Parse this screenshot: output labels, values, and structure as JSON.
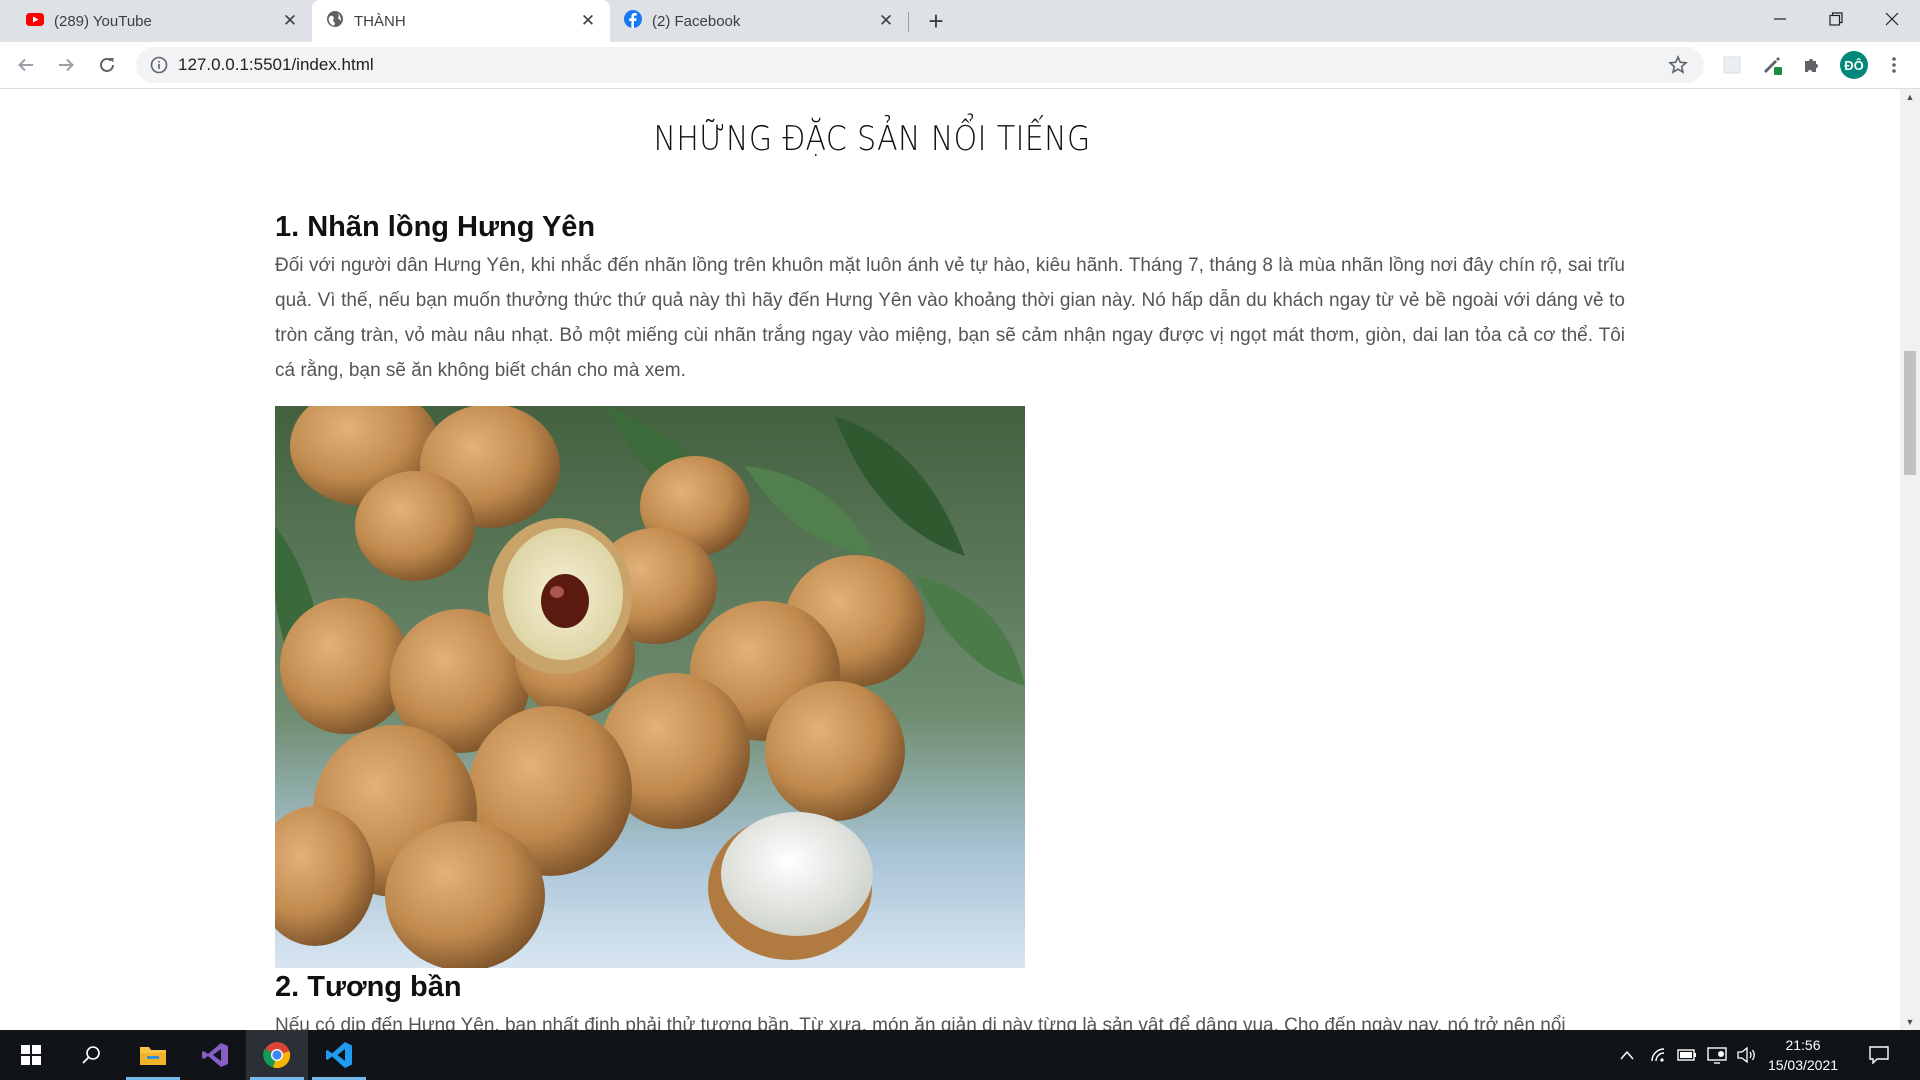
{
  "browser": {
    "tabs": [
      {
        "title": "(289) YouTube",
        "icon": "youtube-icon",
        "active": false
      },
      {
        "title": "THÀNH",
        "icon": "globe-icon",
        "active": true
      },
      {
        "title": "(2) Facebook",
        "icon": "facebook-icon",
        "active": false
      }
    ],
    "close_glyph": "✕",
    "new_tab_glyph": "+",
    "url": "127.0.0.1:5501/index.html",
    "profile_initials": "ĐÔ"
  },
  "page": {
    "title": "NHỮNG ĐẶC SẢN NỔI TIẾNG",
    "sections": [
      {
        "heading": "1. Nhãn lồng Hưng Yên",
        "text": "Đối với người dân Hưng Yên, khi nhắc đến nhãn lồng trên khuôn mặt luôn ánh vẻ tự hào, kiêu hãnh. Tháng 7, tháng 8 là mùa nhãn lồng nơi đây chín rộ, sai trĩu quả. Vì thế, nếu bạn muốn thưởng thức thứ quả này thì hãy đến Hưng Yên vào khoảng thời gian này. Nó hấp dẫn du khách ngay từ vẻ bề ngoài với dáng vẻ to tròn căng tràn, vỏ màu nâu nhạt. Bỏ một miếng cùi nhãn trắng ngay vào miệng, bạn sẽ cảm nhận ngay được vị ngọt mát thơm, giòn, dai lan tỏa cả cơ thể. Tôi cá rằng, bạn sẽ ăn không biết chán cho mà xem."
      },
      {
        "heading": "2. Tương bần",
        "text": "Nếu có dịp đến Hưng Yên, bạn nhất định phải thử tương bần. Từ xưa, món ăn giản dị này từng là sản vật để dâng vua. Cho đến ngày nay, nó trở nên nổi"
      }
    ]
  },
  "taskbar": {
    "apps": [
      "windows-start-icon",
      "search-icon",
      "file-explorer-icon",
      "visual-studio-icon",
      "chrome-icon",
      "vscode-icon"
    ],
    "time": "21:56",
    "date": "15/03/2021"
  },
  "colors": {
    "tab_strip": "#dee1e6",
    "taskbar": "#101418",
    "body_text": "#555555",
    "avatar": "#00897b"
  }
}
